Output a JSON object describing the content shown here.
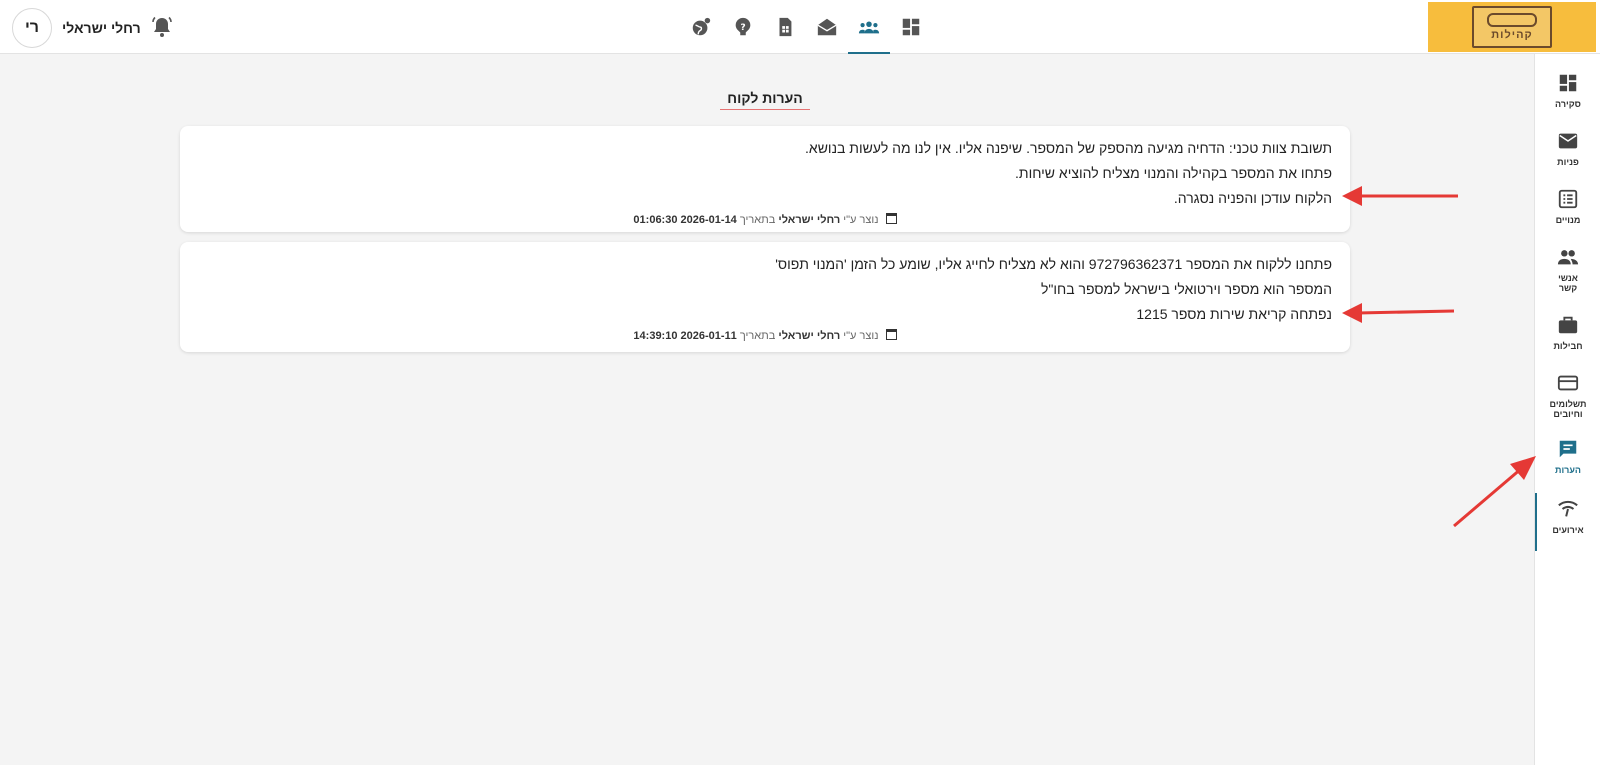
{
  "header": {
    "user_name": "רחלי ישראלי",
    "avatar_initials": "רי",
    "nav_icons": [
      "dashboard-icon",
      "contacts-icon",
      "messages-icon",
      "sim-icon",
      "help-icon",
      "globe-icon"
    ],
    "logo_text": "קהילות"
  },
  "sidebar": {
    "items": [
      {
        "label": "סקירה",
        "icon": "dashboard-icon"
      },
      {
        "label": "פניות",
        "icon": "mail-icon"
      },
      {
        "label": "מנויים",
        "icon": "list-icon"
      },
      {
        "label": "אנשי קשר",
        "icon": "people-icon"
      },
      {
        "label": "חבילות",
        "icon": "briefcase-icon"
      },
      {
        "label": "תשלומים וחיובים",
        "icon": "credit-card-icon"
      },
      {
        "label": "הערות",
        "icon": "comment-icon",
        "active": true
      },
      {
        "label": "אירועים",
        "icon": "signal-icon"
      }
    ]
  },
  "main": {
    "title": "הערות לקוח",
    "notes": [
      {
        "lines": [
          "תשובת צוות טכני: הדחיה מגיעה מהספק של המספר. שיפנה אליו. אין לנו מה לעשות בנושא.",
          "פתחו את המספר בקהילה והמנוי מצליח להוציא שיחות.",
          "הלקוח עודכן והפניה נסגרה."
        ],
        "meta_prefix": "נוצר ע\"י",
        "author": "רחלי ישראלי",
        "date_prefix": "בתאריך",
        "datetime": "2026-01-14 01:06:30"
      },
      {
        "lines": [
          "פתחנו ללקוח את המספר 972796362371 והוא לא מצליח לחייג אליו, שומע כל הזמן 'המנוי תפוס'",
          "המספר הוא מספר וירטואלי בישראל למספר בחו\"ל",
          "נפתחה קריאת שירות מספר 1215"
        ],
        "meta_prefix": "נוצר ע\"י",
        "author": "רחלי ישראלי",
        "date_prefix": "בתאריך",
        "datetime": "2026-01-11 14:39:10"
      }
    ]
  },
  "colors": {
    "accent": "#1f6f8b",
    "logo_bg": "#f7bd3d",
    "arrow": "#e53935"
  }
}
